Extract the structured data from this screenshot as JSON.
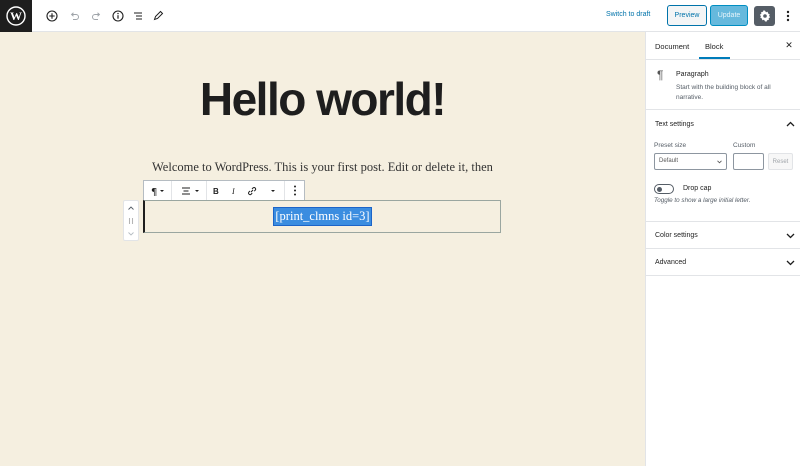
{
  "topbar": {
    "icons": [
      "wordpress-logo",
      "add-block-icon",
      "undo-icon",
      "redo-icon",
      "info-icon",
      "outline-icon",
      "edit-icon"
    ],
    "switch_to_draft": "Switch to draft",
    "preview": "Preview",
    "update": "Update"
  },
  "editor": {
    "title": "Hello world!",
    "paragraph": "Welcome to WordPress. This is your first post. Edit or delete it, then",
    "shortcode": "[print_clmns id=3]"
  },
  "sidebar": {
    "tabs": [
      {
        "label": "Document",
        "active": false
      },
      {
        "label": "Block",
        "active": true
      }
    ],
    "block": {
      "name": "Paragraph",
      "description": "Start with the building block of all narrative."
    },
    "text_settings": {
      "title": "Text settings",
      "preset_size_label": "Preset size",
      "preset_size_value": "Default",
      "custom_label": "Custom",
      "reset": "Reset",
      "drop_cap_label": "Drop cap",
      "drop_cap_help": "Toggle to show a large initial letter."
    },
    "color_settings": "Color settings",
    "advanced": "Advanced"
  },
  "colors": {
    "accent": "#007cba",
    "canvas_bg": "#f5efe0",
    "selection": "#3b8de0"
  }
}
